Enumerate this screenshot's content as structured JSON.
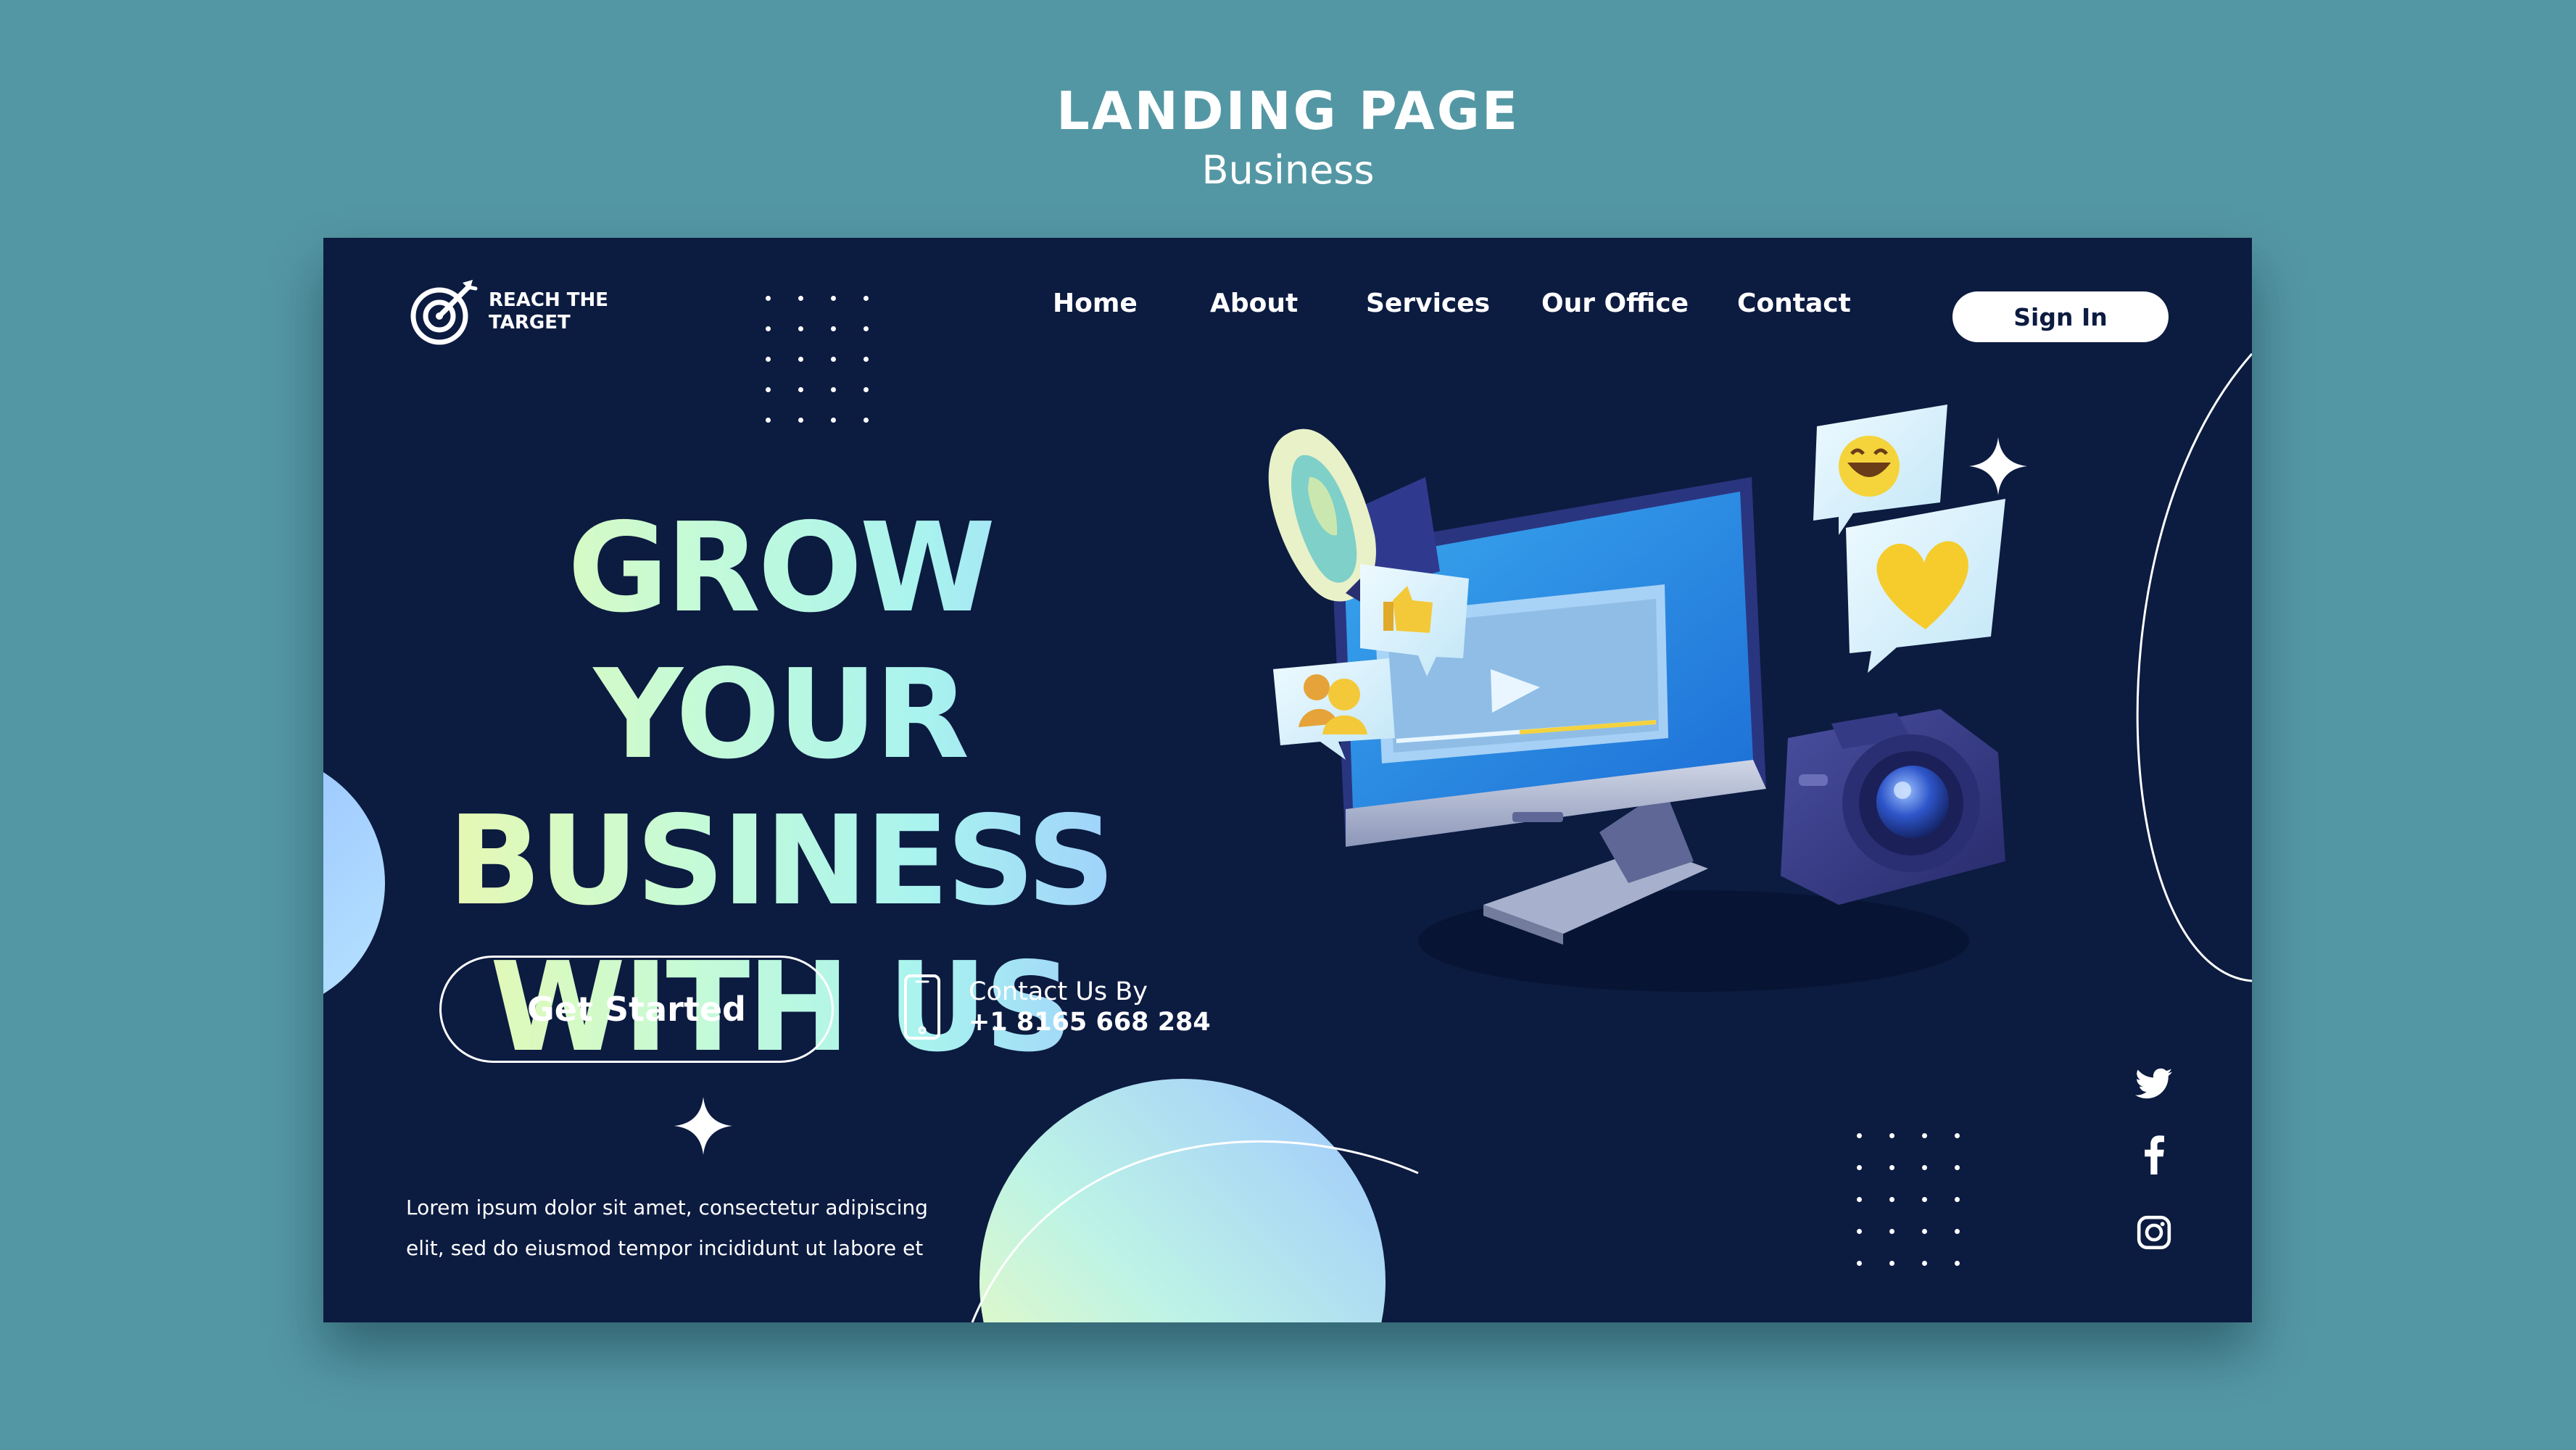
{
  "header": {
    "title": "LANDING PAGE",
    "subtitle": "Business"
  },
  "brand": {
    "name": "REACH THE TARGET"
  },
  "nav": {
    "items": [
      {
        "label": "Home"
      },
      {
        "label": "About"
      },
      {
        "label": "Services"
      },
      {
        "label": "Our Office"
      },
      {
        "label": "Contact"
      }
    ],
    "signin_label": "Sign In"
  },
  "hero": {
    "headline_lines": [
      "GROW YOUR",
      "BUSINESS",
      "WITH US"
    ],
    "cta_label": "Get Started",
    "contact_label": "Contact Us By",
    "phone": "+1 8165 668 284",
    "description_lines": [
      "Lorem ipsum dolor sit amet, consectetur adipiscing",
      "elit, sed do eiusmod tempor incididunt ut labore et"
    ]
  },
  "icons": {
    "logo": "target-arrow-icon",
    "phone": "smartphone-icon",
    "social": [
      "twitter-icon",
      "facebook-icon",
      "instagram-icon"
    ],
    "illustration": [
      "megaphone-icon",
      "monitor-icon",
      "camera-icon",
      "thumbs-up-icon",
      "users-icon",
      "emoji-icon",
      "heart-icon"
    ]
  },
  "colors": {
    "background": "#5497a4",
    "frame": "#0c1b40",
    "headline_gradient": [
      "#f0f7a8",
      "#a9f3ef",
      "#9cc6ff"
    ],
    "accent_blue": "#1aa0e6"
  }
}
